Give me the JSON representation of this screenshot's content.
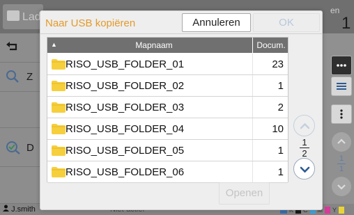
{
  "background": {
    "tab_label": "Lad",
    "top_right_small": "en",
    "top_right_number": "1",
    "side_letters": [
      "Z",
      "D"
    ],
    "page_fraction": {
      "current": "1",
      "total": "1"
    },
    "user": "J.smith",
    "status": "Niet-actief",
    "toner_labels": [
      "K",
      "C",
      "M",
      "Y"
    ],
    "toner_colors": [
      "#1a1a1a",
      "#3fa2d8",
      "#d83a9a",
      "#e8d43a"
    ]
  },
  "dialog": {
    "title": "Naar USB kopiëren",
    "cancel_label": "Annuleren",
    "ok_label": "OK",
    "open_label": "Openen",
    "table": {
      "sort_indicator": "▲",
      "col_name": "Mapnaam",
      "col_docs": "Docum.",
      "rows": [
        {
          "name": "RISO_USB_FOLDER_01",
          "count": "23"
        },
        {
          "name": "RISO_USB_FOLDER_02",
          "count": "1"
        },
        {
          "name": "RISO_USB_FOLDER_03",
          "count": "2"
        },
        {
          "name": "RISO_USB_FOLDER_04",
          "count": "10"
        },
        {
          "name": "RISO_USB_FOLDER_05",
          "count": "1"
        },
        {
          "name": "RISO_USB_FOLDER_06",
          "count": "1"
        }
      ]
    },
    "pager": {
      "current": "1",
      "total": "2"
    }
  },
  "colors": {
    "title_accent": "#e39a2b",
    "folder_yellow": "#f6cf3c",
    "header_gray": "#707070",
    "icon_blue": "#2d5a90"
  },
  "icons": {
    "folder": "folder-icon",
    "scroll_up": "chevron-up-icon",
    "scroll_down": "chevron-down-icon"
  }
}
